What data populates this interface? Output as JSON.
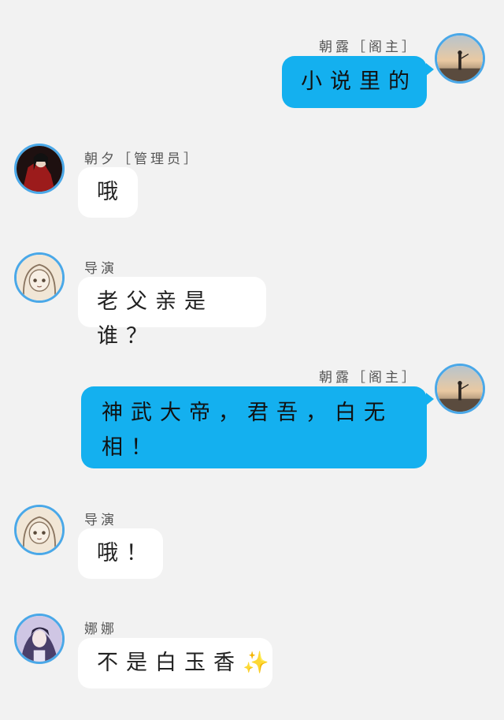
{
  "messages": [
    {
      "sender": "朝露［阁主］",
      "text": "小说里的",
      "direction": "outgoing",
      "avatar": "sunset-figure-avatar-icon"
    },
    {
      "sender": "朝夕［管理员］",
      "text": "哦",
      "direction": "incoming",
      "avatar": "red-robed-figure-avatar-icon"
    },
    {
      "sender": "导演",
      "text": "老父亲是谁？",
      "direction": "incoming",
      "avatar": "anime-sketch-avatar-icon"
    },
    {
      "sender": "朝露［阁主］",
      "text": "神武大帝，君吾，白无",
      "text2": "相！",
      "direction": "outgoing",
      "avatar": "sunset-figure-avatar-icon"
    },
    {
      "sender": "导演",
      "text": "哦！",
      "direction": "incoming",
      "avatar": "anime-sketch-avatar-icon"
    },
    {
      "sender": "娜娜",
      "text": "不是白玉香",
      "emoji": "✨",
      "direction": "incoming",
      "avatar": "lavender-portrait-avatar-icon"
    }
  ],
  "colors": {
    "background": "#f2f2f2",
    "outgoing_bubble": "#14b0ef",
    "incoming_bubble": "#ffffff",
    "avatar_ring": "#4aa8e8"
  }
}
